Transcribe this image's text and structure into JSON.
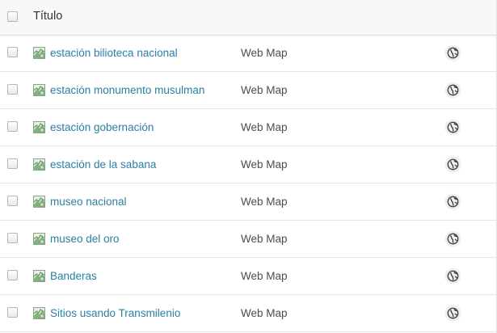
{
  "header": {
    "title": "Título"
  },
  "rows": [
    {
      "title": "estación bilioteca nacional",
      "type": "Web Map",
      "icon": "web-map-icon",
      "share_icon": "public-globe-icon"
    },
    {
      "title": "estación monumento musulman",
      "type": "Web Map",
      "icon": "web-map-icon",
      "share_icon": "public-globe-icon"
    },
    {
      "title": "estación gobernación",
      "type": "Web Map",
      "icon": "web-map-icon",
      "share_icon": "public-globe-icon"
    },
    {
      "title": "estación de la sabana",
      "type": "Web Map",
      "icon": "web-map-icon",
      "share_icon": "public-globe-icon"
    },
    {
      "title": "museo nacional",
      "type": "Web Map",
      "icon": "web-map-icon",
      "share_icon": "public-globe-icon"
    },
    {
      "title": "museo del oro",
      "type": "Web Map",
      "icon": "web-map-icon",
      "share_icon": "public-globe-icon"
    },
    {
      "title": "Banderas",
      "type": "Web Map",
      "icon": "web-map-icon",
      "share_icon": "public-globe-icon"
    },
    {
      "title": "Sitios usando Transmilenio",
      "type": "Web Map",
      "icon": "web-map-icon",
      "share_icon": "public-globe-icon"
    }
  ],
  "colors": {
    "link": "#2b7fa3",
    "text": "#4c4c4c",
    "header_bg": "#f8f8f8",
    "divider": "#e6e6e6"
  }
}
